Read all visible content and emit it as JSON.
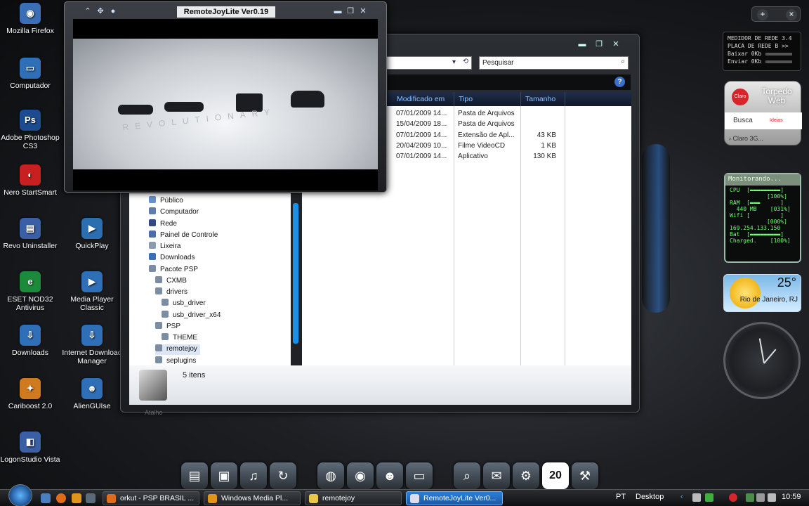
{
  "desktop_icons": [
    {
      "label": "Mozilla Firefox",
      "icon": "firefox-icon",
      "color": "#3b6fb5"
    },
    {
      "label": "Computador",
      "icon": "computer-icon",
      "color": "#2f6fb8"
    },
    {
      "label": "Adobe Photoshop CS3",
      "icon": "photoshop-icon",
      "color": "#1d4b8f"
    },
    {
      "label": "Nero StartSmart",
      "icon": "nero-icon",
      "color": "#c82020"
    },
    {
      "label": "Revo Uninstaller",
      "icon": "revo-icon",
      "color": "#3a5fa5"
    },
    {
      "label": "QuickPlay",
      "icon": "quickplay-icon",
      "color": "#2b6fb0"
    },
    {
      "label": "ESET NOD32 Antivirus",
      "icon": "eset-icon",
      "color": "#1b8a3b"
    },
    {
      "label": "Media Player Classic",
      "icon": "mpc-icon",
      "color": "#2f6fb8"
    },
    {
      "label": "Downloads",
      "icon": "downloads-icon",
      "color": "#2f6fb8"
    },
    {
      "label": "Internet Download Manager",
      "icon": "idm-icon",
      "color": "#2f6fb8"
    },
    {
      "label": "Cariboost 2.0",
      "icon": "cariboost-icon",
      "color": "#d07a20"
    },
    {
      "label": "AlienGUIse",
      "icon": "alienguise-icon",
      "color": "#2f6fb8"
    },
    {
      "label": "LogonStudio Vista",
      "icon": "logonstudio-icon",
      "color": "#3a5fa5"
    }
  ],
  "remotejoy": {
    "title": "RemoteJoyLite Ver0.19",
    "screen_text": "REVOLUTIONARY"
  },
  "explorer": {
    "search_placeholder": "Pesquisar",
    "columns": [
      "Modificado em",
      "Tipo",
      "Tamanho"
    ],
    "files": [
      {
        "date": "07/01/2009 14...",
        "type": "Pasta de Arquivos",
        "size": ""
      },
      {
        "date": "15/04/2009 18...",
        "type": "Pasta de Arquivos",
        "size": ""
      },
      {
        "date": "07/01/2009 14...",
        "type": "Extensão de Apl...",
        "size": "43 KB"
      },
      {
        "date": "20/04/2009 10...",
        "type": "Filme VideoCD",
        "size": "1 KB"
      },
      {
        "date": "07/01/2009 14...",
        "type": "Aplicativo",
        "size": "130 KB"
      }
    ],
    "nav": [
      {
        "label": "Público",
        "indent": 0
      },
      {
        "label": "Computador",
        "indent": 0
      },
      {
        "label": "Rede",
        "indent": 0
      },
      {
        "label": "Painel de Controle",
        "indent": 0
      },
      {
        "label": "Lixeira",
        "indent": 0
      },
      {
        "label": "Downloads",
        "indent": 0
      },
      {
        "label": "Pacote PSP",
        "indent": 0
      },
      {
        "label": "CXMB",
        "indent": 1
      },
      {
        "label": "drivers",
        "indent": 1
      },
      {
        "label": "usb_driver",
        "indent": 2
      },
      {
        "label": "usb_driver_x64",
        "indent": 2
      },
      {
        "label": "PSP",
        "indent": 1
      },
      {
        "label": "THEME",
        "indent": 2
      },
      {
        "label": "remotejoy",
        "indent": 1,
        "selected": true
      },
      {
        "label": "seplugins",
        "indent": 1
      }
    ],
    "status": "5 itens",
    "below_status": "Atalho"
  },
  "gadgets": {
    "netmeter": {
      "line1": "MEDIDOR DE REDE 3.4",
      "line2": "PLACA DE REDE B >>",
      "down_label": "Baixar",
      "down_val": "0Kb",
      "up_label": "Enviar",
      "up_val": "0Kb"
    },
    "claro": {
      "logo": "Claro",
      "title": "Torpedo Web",
      "search": "Busca",
      "brand": "Ideias",
      "more": "› Claro 3G..."
    },
    "monitor": {
      "title": "Monitorando...",
      "lines": [
        "CPU  [▬▬▬▬▬▬▬▬▬]",
        "           [100%]",
        "RAM  [▬▬▬      ]",
        "  440 MB    [031%]",
        "Wifi [         ]",
        "           [000%]",
        "169.254.133.150",
        "Bat  [▬▬▬▬▬▬▬▬▬]",
        "Charged.    [100%]"
      ]
    },
    "weather": {
      "temp": "25°",
      "city": "Rio de Janeiro, RJ"
    }
  },
  "dock": {
    "calendar_day": "20"
  },
  "taskbar": {
    "tasks": [
      {
        "label": "orkut - PSP BRASIL ...",
        "icon": "firefox-icon",
        "color": "#e06b1a",
        "active": false
      },
      {
        "label": "Windows Media Pl...",
        "icon": "wmp-icon",
        "color": "#e0951a",
        "active": false
      },
      {
        "label": "remotejoy",
        "icon": "folder-icon",
        "color": "#e8c84a",
        "active": false
      },
      {
        "label": "RemoteJoyLite Ver0...",
        "icon": "rjl-icon",
        "color": "#dde",
        "active": true
      }
    ],
    "lang": "PT",
    "desktop": "Desktop",
    "time": "10:59"
  },
  "colors": {
    "accent": "#1a90e8",
    "taskbar_active": "#2a7fd8"
  }
}
